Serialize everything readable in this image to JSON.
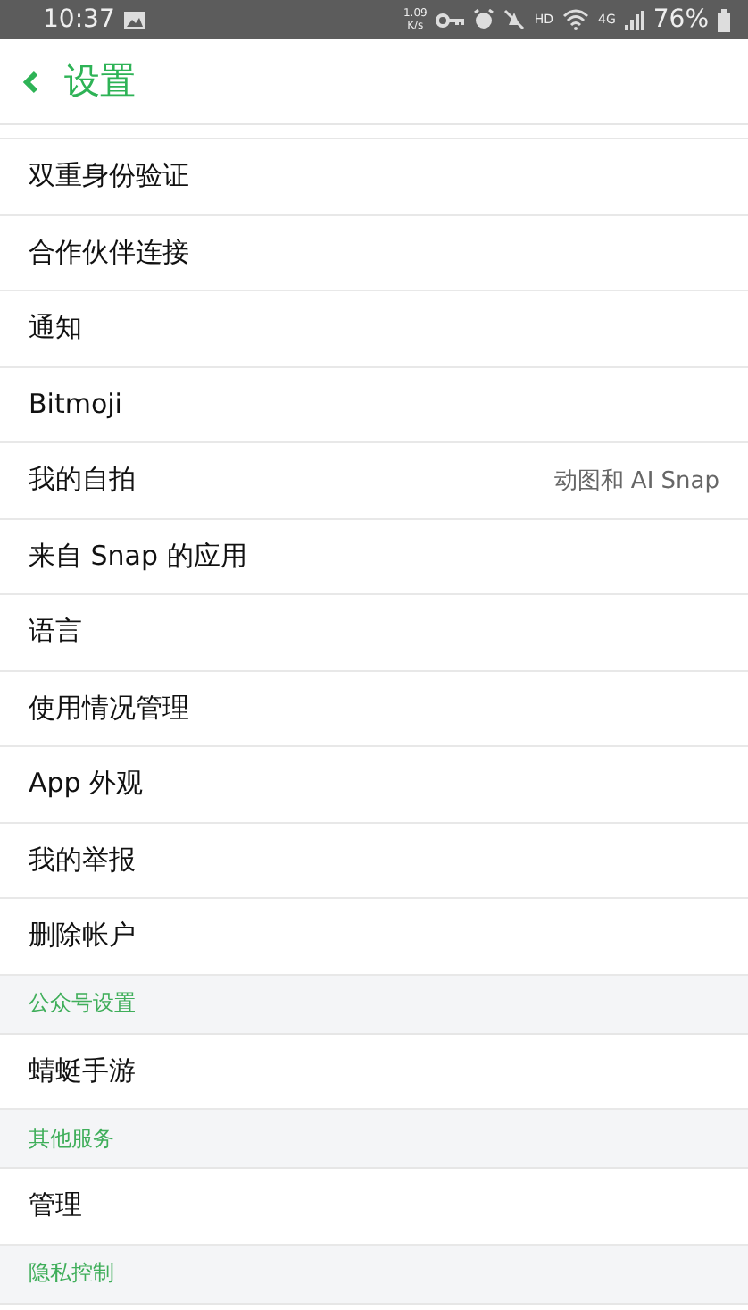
{
  "status_bar": {
    "time": "10:37",
    "speed_value": "1.09",
    "speed_unit": "K/s",
    "hd": "HD",
    "network": "4G",
    "battery": "76%"
  },
  "header": {
    "title": "设置"
  },
  "sections": [
    {
      "items": [
        {
          "label": "双重身份验证"
        },
        {
          "label": "合作伙伴连接"
        },
        {
          "label": "通知"
        },
        {
          "label": "Bitmoji"
        },
        {
          "label": "我的自拍",
          "value": "动图和 AI Snap"
        },
        {
          "label": "来自 Snap 的应用"
        },
        {
          "label": "语言"
        },
        {
          "label": "使用情况管理"
        },
        {
          "label": "App 外观"
        },
        {
          "label": "我的举报"
        },
        {
          "label": "删除帐户"
        }
      ]
    },
    {
      "title": "公众号设置",
      "items": [
        {
          "label": "蜻蜓手游"
        }
      ]
    },
    {
      "title": "其他服务",
      "items": [
        {
          "label": "管理"
        }
      ]
    },
    {
      "title": "隐私控制"
    }
  ]
}
